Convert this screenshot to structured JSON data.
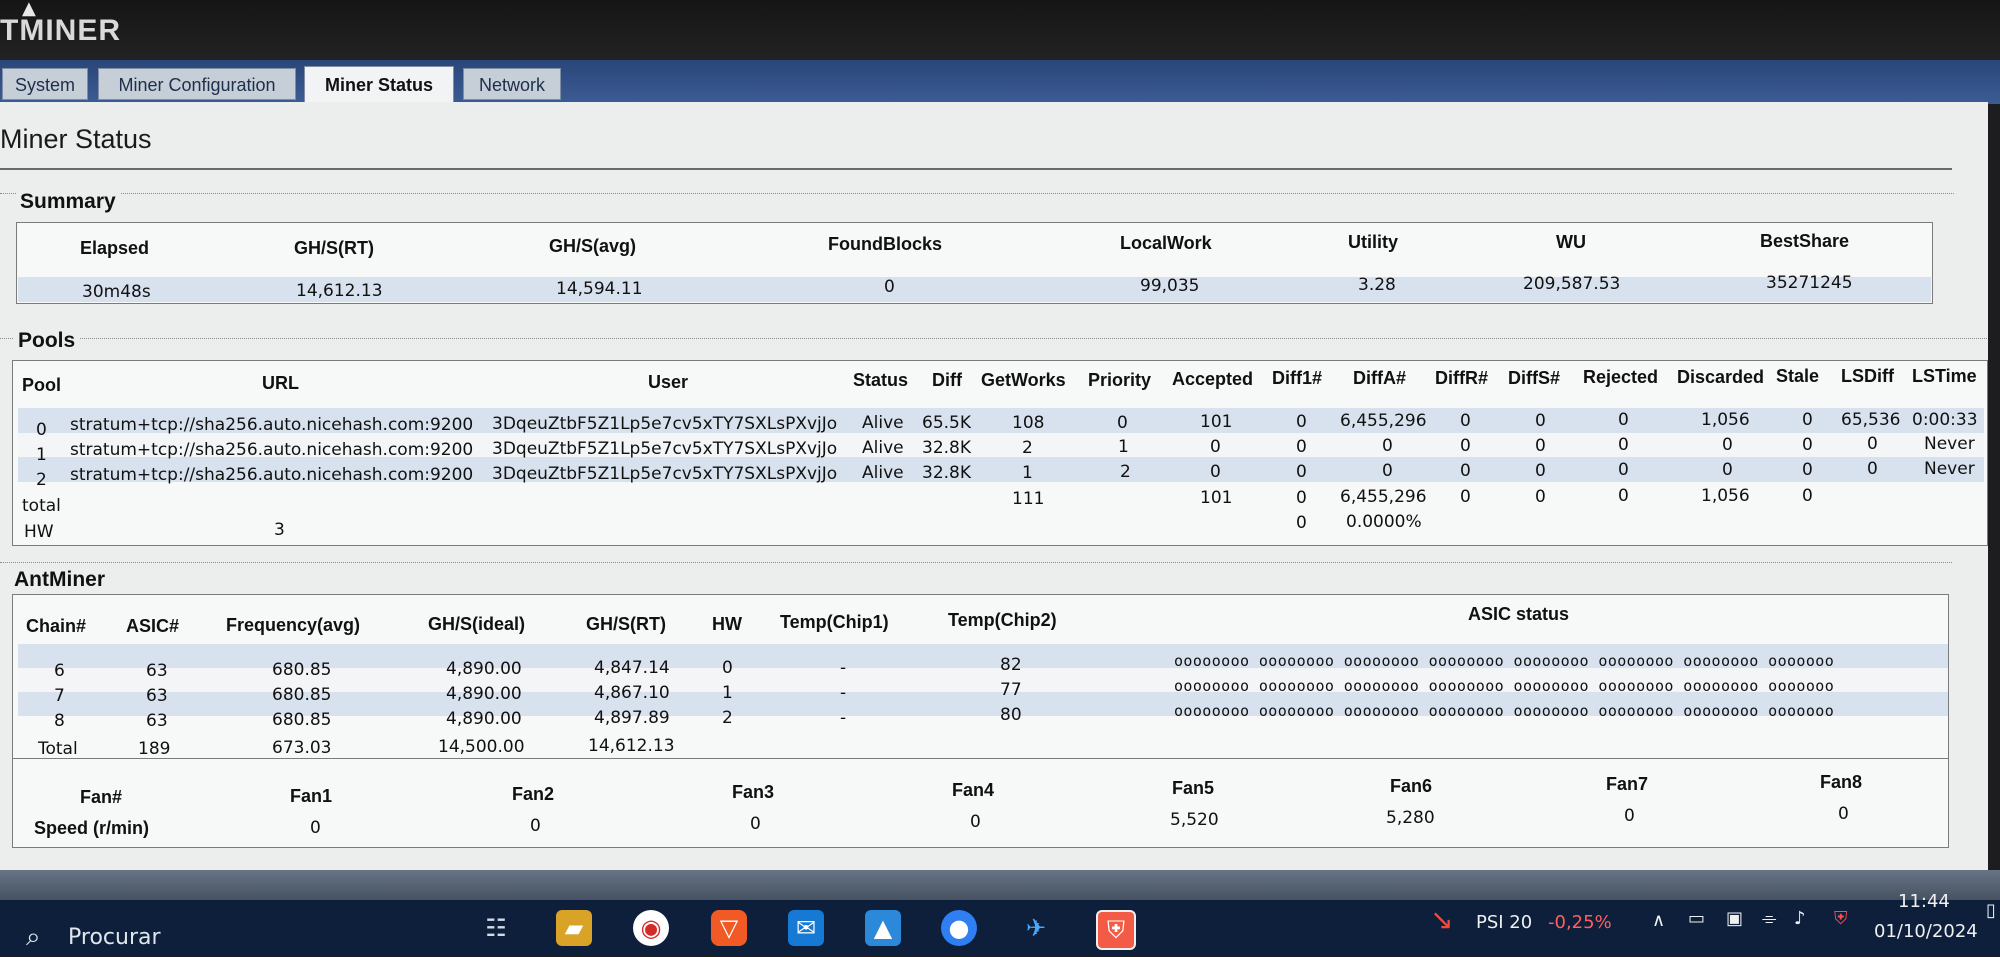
{
  "app": {
    "brand": "TMINER"
  },
  "tabs": [
    {
      "label": "System"
    },
    {
      "label": "Miner Configuration"
    },
    {
      "label": "Miner Status"
    },
    {
      "label": "Network"
    }
  ],
  "page": {
    "title": "Miner Status"
  },
  "summary": {
    "title": "Summary",
    "columns": [
      "Elapsed",
      "GH/S(RT)",
      "GH/S(avg)",
      "FoundBlocks",
      "LocalWork",
      "Utility",
      "WU",
      "BestShare"
    ],
    "values": [
      "30m48s",
      "14,612.13",
      "14,594.11",
      "0",
      "99,035",
      "3.28",
      "209,587.53",
      "35271245"
    ]
  },
  "pools": {
    "title": "Pools",
    "columns": [
      "Pool",
      "URL",
      "User",
      "Status",
      "Diff",
      "GetWorks",
      "Priority",
      "Accepted",
      "Diff1#",
      "DiffA#",
      "DiffR#",
      "DiffS#",
      "Rejected",
      "Discarded",
      "Stale",
      "LSDiff",
      "LSTime"
    ],
    "rows": [
      [
        "0",
        "stratum+tcp://sha256.auto.nicehash.com:9200",
        "3DqeuZtbF5Z1Lp5e7cv5xTY7SXLsPXvjJo",
        "Alive",
        "65.5K",
        "108",
        "0",
        "101",
        "0",
        "6,455,296",
        "0",
        "0",
        "0",
        "1,056",
        "0",
        "65,536",
        "0:00:33"
      ],
      [
        "1",
        "stratum+tcp://sha256.auto.nicehash.com:9200",
        "3DqeuZtbF5Z1Lp5e7cv5xTY7SXLsPXvjJo",
        "Alive",
        "32.8K",
        "2",
        "1",
        "0",
        "0",
        "0",
        "0",
        "0",
        "0",
        "0",
        "0",
        "0",
        "Never"
      ],
      [
        "2",
        "stratum+tcp://sha256.auto.nicehash.com:9200",
        "3DqeuZtbF5Z1Lp5e7cv5xTY7SXLsPXvjJo",
        "Alive",
        "32.8K",
        "1",
        "2",
        "0",
        "0",
        "0",
        "0",
        "0",
        "0",
        "0",
        "0",
        "0",
        "Never"
      ]
    ],
    "total": {
      "label": "total",
      "getworks": "111",
      "accepted": "101",
      "diff1": "0",
      "diffa": "6,455,296",
      "diffr": "0",
      "diffs": "0",
      "rejected": "0",
      "discarded": "1,056",
      "stale": "0"
    },
    "hw": {
      "label": "HW",
      "value": "3",
      "diff1": "0",
      "diffa": "0.0000%"
    }
  },
  "antminer": {
    "title": "AntMiner",
    "columns": [
      "Chain#",
      "ASIC#",
      "Frequency(avg)",
      "GH/S(ideal)",
      "GH/S(RT)",
      "HW",
      "Temp(Chip1)",
      "Temp(Chip2)",
      "ASIC status"
    ],
    "rows": [
      [
        "6",
        "63",
        "680.85",
        "4,890.00",
        "4,847.14",
        "0",
        "-",
        "82",
        "oooooooo oooooooo oooooooo oooooooo oooooooo oooooooo oooooooo ooooooo"
      ],
      [
        "7",
        "63",
        "680.85",
        "4,890.00",
        "4,867.10",
        "1",
        "-",
        "77",
        "oooooooo oooooooo oooooooo oooooooo oooooooo oooooooo oooooooo ooooooo"
      ],
      [
        "8",
        "63",
        "680.85",
        "4,890.00",
        "4,897.89",
        "2",
        "-",
        "80",
        "oooooooo oooooooo oooooooo oooooooo oooooooo oooooooo oooooooo ooooooo"
      ]
    ],
    "total": [
      "Total",
      "189",
      "673.03",
      "14,500.00",
      "14,612.13"
    ]
  },
  "fans": {
    "header_label": "Fan#",
    "speed_label": "Speed (r/min)",
    "names": [
      "Fan1",
      "Fan2",
      "Fan3",
      "Fan4",
      "Fan5",
      "Fan6",
      "Fan7",
      "Fan8"
    ],
    "speeds": [
      "0",
      "0",
      "0",
      "0",
      "5,520",
      "5,280",
      "0",
      "0"
    ]
  },
  "taskbar": {
    "search_placeholder": "Procurar",
    "stock_label": "PSI 20",
    "stock_change": "-0,25%",
    "time": "11:44",
    "date": "01/10/2024"
  },
  "colors": {
    "selected_row": "#d8e2ef",
    "tab_bar": "#2a4679",
    "page_bg": "#eceeee"
  }
}
